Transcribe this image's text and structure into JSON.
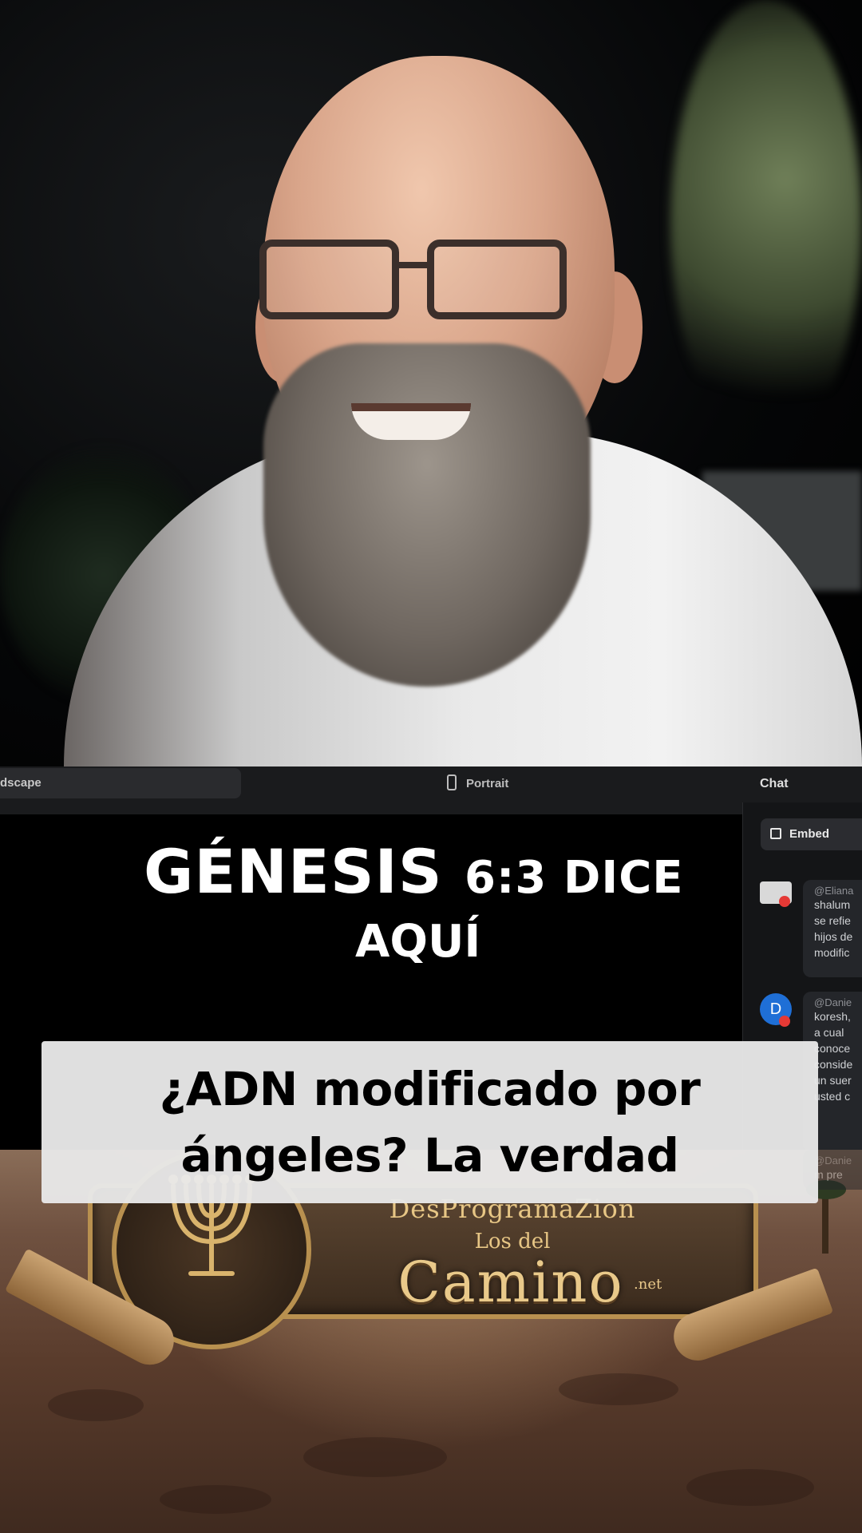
{
  "studio": {
    "tabs": [
      {
        "label": "dscape",
        "active": true
      },
      {
        "label": "Portrait",
        "active": false
      }
    ],
    "chat_title": "Chat",
    "embed_label": "Embed"
  },
  "chat_messages": [
    {
      "author": "@Eliana",
      "lines": [
        "shalum",
        "se refie",
        "hijos de",
        "modific"
      ]
    },
    {
      "author": "@Danie",
      "avatar_letter": "D",
      "lines": [
        "koresh,",
        "a cual",
        "conoce",
        "conside",
        "un suer",
        "usted c"
      ]
    },
    {
      "author": "@Danie",
      "lines": [
        "m pre"
      ]
    }
  ],
  "caption": {
    "line1_big": "GÉNESIS",
    "line1_small": "6:3 DICE",
    "line2": "AQUÍ"
  },
  "title_overlay": {
    "line1": "¿ADN modificado por",
    "line2": "ángeles? La verdad"
  },
  "brand": {
    "top": "DesProgramaZion",
    "mid": "Los del",
    "main": "Camino",
    "suffix": ".net"
  },
  "colors": {
    "caption_text": "#ffffff",
    "title_box": "#e8e8e8",
    "brand_gold": "#e9c98a",
    "chat_avatar": "#1f6fd6",
    "youtube_badge": "#e53935"
  },
  "icons": [
    "phone-icon",
    "embed-icon",
    "youtube-badge-icon",
    "menorah-icon",
    "shofar-horn-icon"
  ]
}
